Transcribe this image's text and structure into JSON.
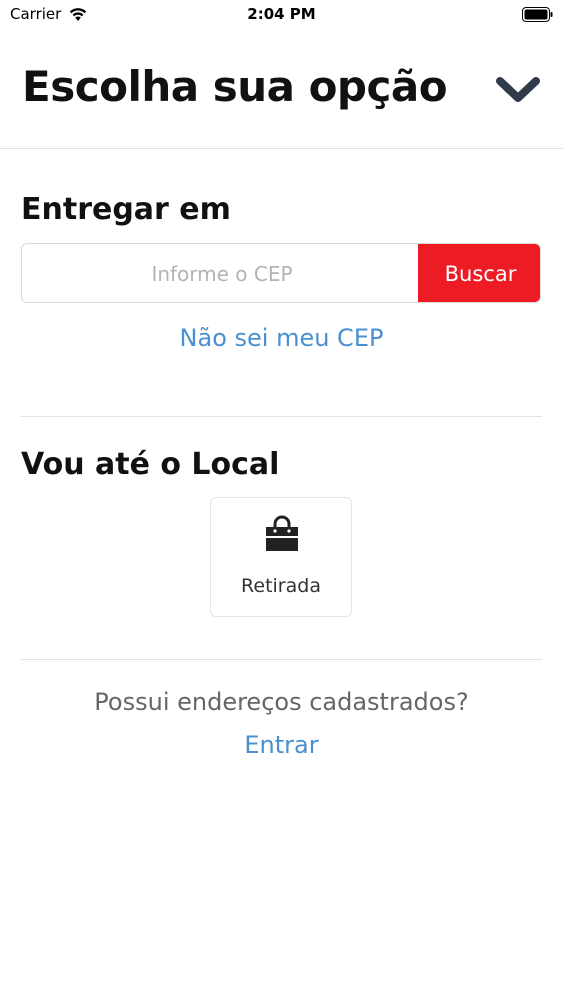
{
  "status_bar": {
    "carrier": "Carrier",
    "time": "2:04 PM",
    "icons": [
      "wifi-icon",
      "battery-icon"
    ]
  },
  "header": {
    "title": "Escolha sua opção",
    "toggle_icon": "chevron-down-icon"
  },
  "delivery": {
    "heading": "Entregar em",
    "cep_placeholder": "Informe o CEP",
    "cep_value": "",
    "search_label": "Buscar",
    "unknown_cep_link": "Não sei meu CEP"
  },
  "pickup": {
    "heading": "Vou até o Local",
    "option_icon": "shopping-bag-icon",
    "option_label": "Retirada"
  },
  "account": {
    "question": "Possui endereços cadastrados?",
    "login_link": "Entrar"
  },
  "colors": {
    "accent_red": "#ed1c24",
    "link_blue": "#4a90d0",
    "divider": "#e2e2e2"
  }
}
